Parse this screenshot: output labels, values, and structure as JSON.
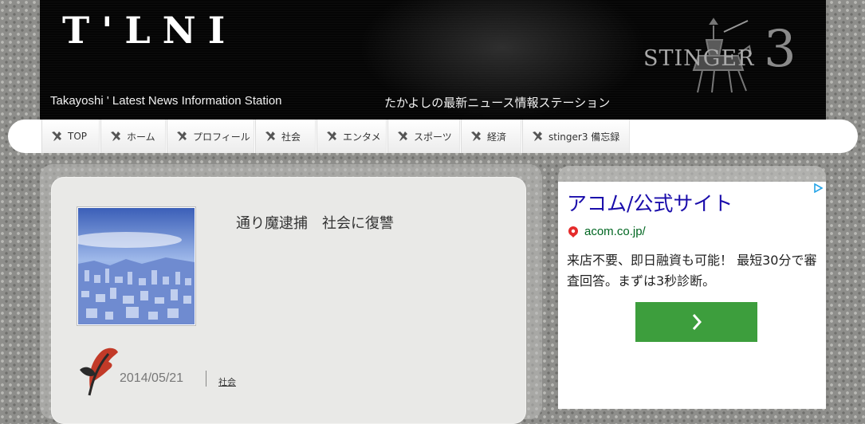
{
  "header": {
    "site_title": "T'LNI",
    "tagline_en": "Takayoshi ' Latest News Information Station",
    "tagline_ja": "たかよしの最新ニュース情報ステーション",
    "theme_logo_text": "STINGER",
    "theme_logo_number": "3"
  },
  "nav": {
    "items": [
      {
        "label": "TOP"
      },
      {
        "label": "ホーム"
      },
      {
        "label": "プロフィール"
      },
      {
        "label": "社会"
      },
      {
        "label": "エンタメ"
      },
      {
        "label": "スポーツ"
      },
      {
        "label": "経済"
      },
      {
        "label": "stinger3 備忘録"
      }
    ],
    "icon": "tools-icon"
  },
  "article": {
    "title": "通り魔逮捕　社会に復讐",
    "date": "2014/05/21",
    "category": "社会"
  },
  "ad": {
    "headline": "アコム/公式サイト",
    "url": "acom.co.jp/",
    "body": "来店不要、即日融資も可能！ 最短30分で審査回答。まずは3秒診断。",
    "cta_icon": "chevron-right-icon",
    "choices_icon": "adchoices-icon",
    "colors": {
      "headline": "#1a0dab",
      "url": "#006621",
      "cta": "#3d9e3d"
    }
  }
}
